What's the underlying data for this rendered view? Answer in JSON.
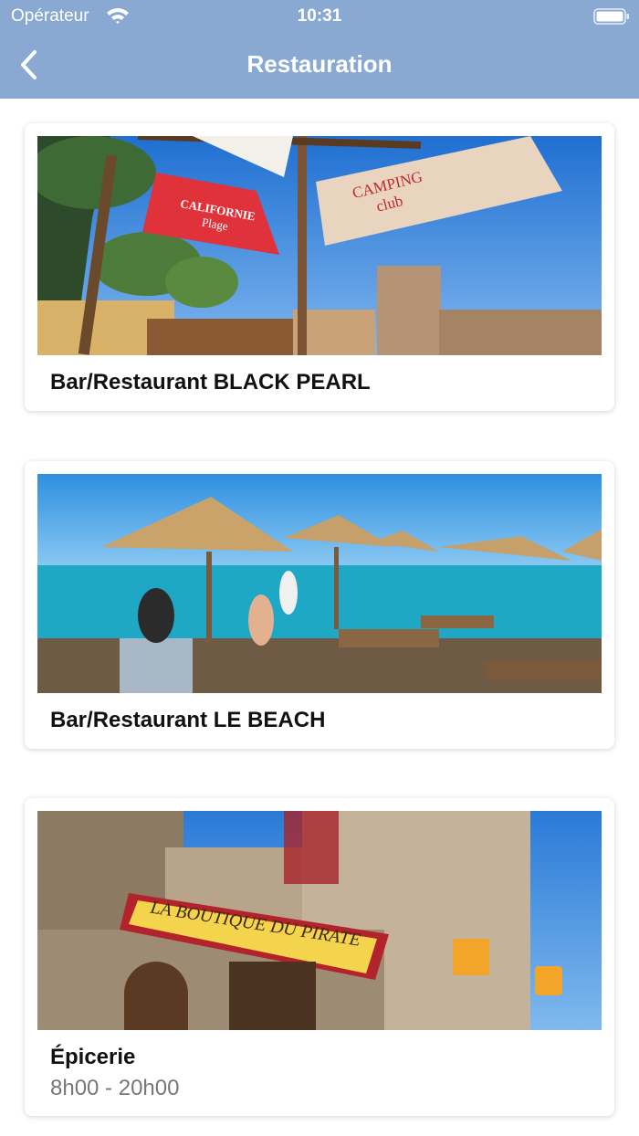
{
  "status_bar": {
    "carrier": "Opérateur",
    "time": "10:31"
  },
  "nav": {
    "title": "Restauration",
    "back_icon": "chevron-left-icon"
  },
  "cards": [
    {
      "title": "Bar/Restaurant BLACK PEARL",
      "subtitle": "",
      "image": {
        "banner_1_line1": "CALIFORNIE",
        "banner_1_line2": "Plage",
        "banner_2_line1": "CAMPING",
        "banner_2_line2": "club"
      }
    },
    {
      "title": "Bar/Restaurant LE BEACH",
      "subtitle": ""
    },
    {
      "title": "Épicerie",
      "subtitle": "8h00 - 20h00",
      "image": {
        "sign": "LA BOUTIQUE DU PIRATE"
      }
    }
  ],
  "colors": {
    "header": "#89a9d3",
    "card_bg": "#ffffff"
  }
}
